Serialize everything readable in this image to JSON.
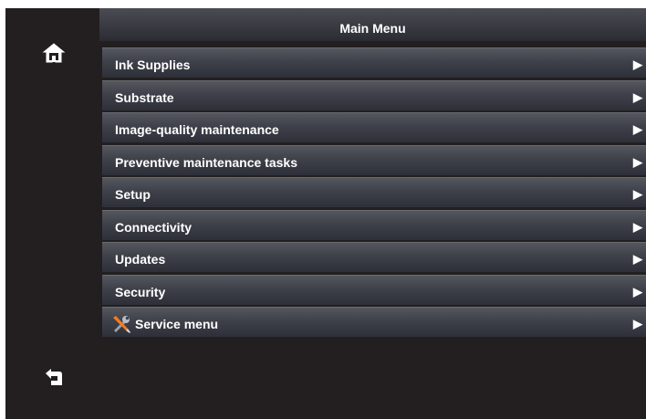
{
  "header": {
    "title": "Main Menu"
  },
  "side": {
    "home_icon": "home-icon",
    "back_icon": "back-arrow-icon"
  },
  "menu": {
    "arrow_glyph": "▶",
    "items": [
      {
        "label": "Ink Supplies"
      },
      {
        "label": "Substrate"
      },
      {
        "label": "Image-quality maintenance"
      },
      {
        "label": "Preventive maintenance tasks"
      },
      {
        "label": "Setup"
      },
      {
        "label": "Connectivity"
      },
      {
        "label": "Updates"
      },
      {
        "label": "Security"
      },
      {
        "label": "Service menu",
        "icon": "service-tools-icon"
      }
    ]
  },
  "colors": {
    "background": "#231f20",
    "accent_orange": "#f47b20"
  }
}
